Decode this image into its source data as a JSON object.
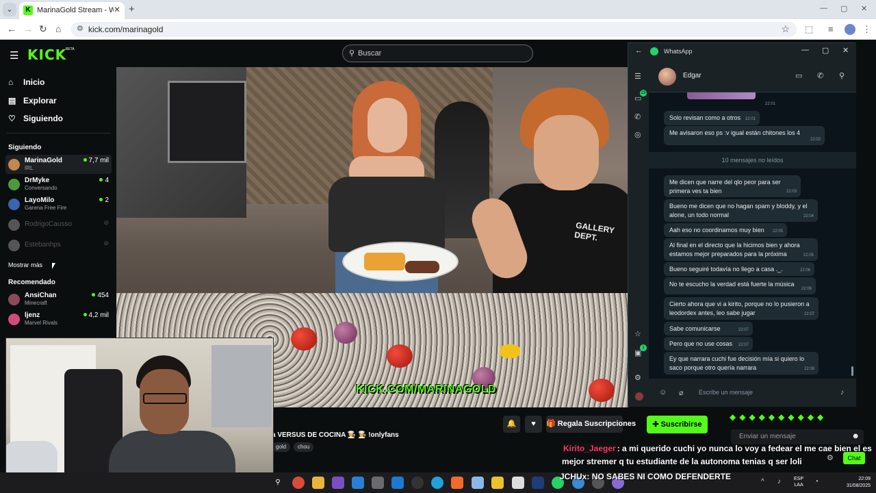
{
  "browser": {
    "tab_title": "MarinaGold Stream - Watch",
    "url": "kick.com/marinagold"
  },
  "kick": {
    "logo": "KICK",
    "logo_beta": "BETA",
    "search_placeholder": "Buscar",
    "nav": [
      {
        "label": "Inicio",
        "icon": "home-icon"
      },
      {
        "label": "Explorar",
        "icon": "explore-icon"
      },
      {
        "label": "Siguiendo",
        "icon": "heart-icon"
      }
    ],
    "following_header": "Siguiendo",
    "following": [
      {
        "name": "MarinaGold",
        "sub": "IRL",
        "viewers": "7,7 mil",
        "live": true,
        "avatar_color": "#c2884c"
      },
      {
        "name": "DrMyke",
        "sub": "Conversando",
        "viewers": "4",
        "live": true,
        "avatar_color": "#4e9a3a"
      },
      {
        "name": "LayoMilo",
        "sub": "Garena Free Fire",
        "viewers": "2",
        "live": true,
        "avatar_color": "#3a66b0"
      },
      {
        "name": "RodrigoCausso",
        "sub": "",
        "viewers": "",
        "live": false,
        "avatar_color": "#555555"
      },
      {
        "name": "Estebanhps",
        "sub": "",
        "viewers": "",
        "live": false,
        "avatar_color": "#555555"
      }
    ],
    "show_more": "Mostrar más",
    "recommended_header": "Recomendado",
    "recommended": [
      {
        "name": "AnsiChan",
        "sub": "Minecraft",
        "viewers": "454",
        "avatar_color": "#8b4a5c"
      },
      {
        "name": "ljenz",
        "sub": "Marvel Rivals",
        "viewers": "4,2 mil",
        "avatar_color": "#d44a7a"
      }
    ],
    "video_watermark": "KICK.COM/MARINAGOLD",
    "shirt_text": "GALLERY DEPT.",
    "stream_title": "a VERSUS DE COCINA 👩‍🍳 👩‍🍳 !onlyfans",
    "tags": [
      "gold",
      "chou"
    ],
    "gift_label": "Regala Suscripciones",
    "subscribe_label": "Suscribirse",
    "chat_placeholder": "Enviar un mensaje",
    "chat_button": "Chat"
  },
  "captions": [
    {
      "user": "Kirito_Jaeger",
      "text": ": a mi querido cuchi yo nunca lo voy a fedear el me cae bien el es"
    },
    {
      "user": "",
      "text": "mejor stremer q tu estudiante de la autonoma tenias q ser loli"
    },
    {
      "user": "JCHUx",
      "text": ": NO SABES NI COMO DEFENDERTE"
    }
  ],
  "whatsapp": {
    "app_name": "WhatsApp",
    "contact": "Edgar",
    "unread_label": "10 mensajes no leídos",
    "compose_placeholder": "Escribe un mensaje",
    "rail_badges": [
      "23",
      "1"
    ],
    "messages_before": [
      {
        "text": "",
        "time": "22:01"
      },
      {
        "text": "Solo revisan como a otros",
        "time": "22:01"
      },
      {
        "text": "Me avisaron eso ps :v igual están chitones los 4",
        "time": "22:02"
      }
    ],
    "messages_after": [
      {
        "text": "Me dicen que narre del qlo peor para ser primera ves ta bien",
        "time": "22:03"
      },
      {
        "text": "Bueno me dicen que no hagan spam y bloddy, y el alone, un todo normal",
        "time": "22:04"
      },
      {
        "text": "Aah eso no coordinamos muy bien",
        "time": "22:05"
      },
      {
        "text": "Al final en el directo que la hicimos bien y ahora estamos mejor preparados para la próxima",
        "time": "22:05"
      },
      {
        "text": "Bueno seguiré todavía no llego a casa ._.",
        "time": "22:06"
      },
      {
        "text": "No te escucho la verdad está fuerte la música",
        "time": "22:06"
      },
      {
        "text": "Cierto ahora que vi a kirito, porque no lo pusieron a leodordex antes, leo sabe jugar",
        "time": "22:07"
      },
      {
        "text": "Sabe comunicarse",
        "time": "22:07"
      },
      {
        "text": "Pero que no use cosas",
        "time": "22:07"
      },
      {
        "text": "Ey que narrara cuchi fue decisión mía si quiero lo saco porque otro quería narrara",
        "time": "22:08"
      }
    ]
  },
  "taskbar": {
    "lang_top": "ESP",
    "lang_bottom": "LAA",
    "time": "22:09",
    "date": "31/08/2025"
  }
}
